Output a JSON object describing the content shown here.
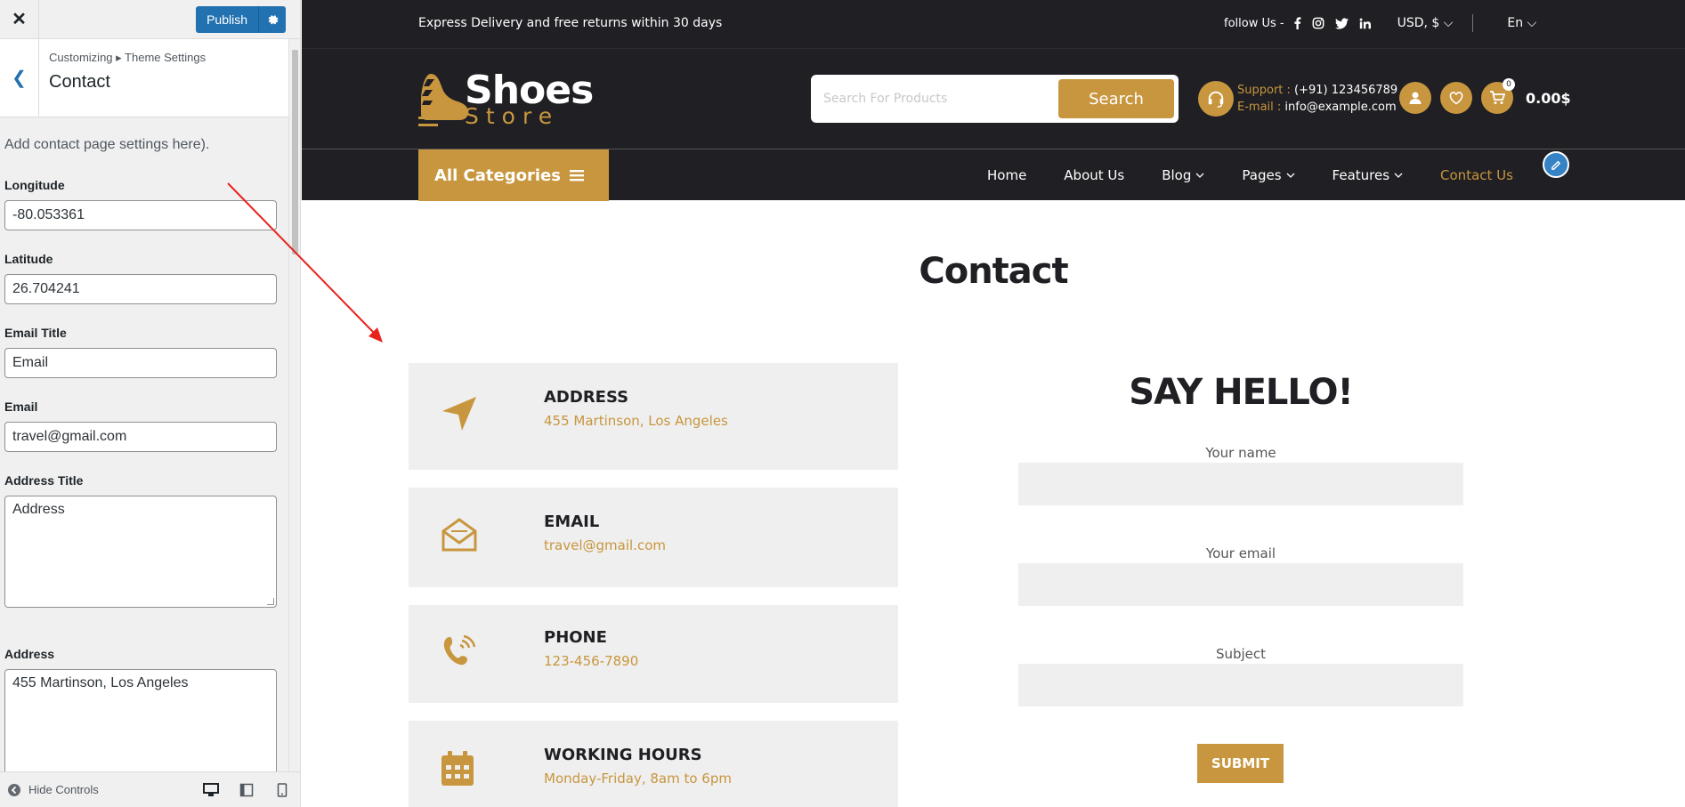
{
  "customizer": {
    "publish_label": "Publish",
    "breadcrumb": "Customizing ▸ Theme Settings",
    "section_title": "Contact",
    "description": "Add contact page settings here).",
    "fields": [
      {
        "label": "Longitude",
        "value": "-80.053361"
      },
      {
        "label": "Latitude",
        "value": "26.704241"
      },
      {
        "label": "Email Title",
        "value": "Email"
      },
      {
        "label": "Email",
        "value": "travel@gmail.com"
      }
    ],
    "address_title_label": "Address Title",
    "address_title_value": "Address",
    "address_label": "Address",
    "address_value": "455 Martinson, Los Angeles",
    "hide_controls": "Hide Controls"
  },
  "site": {
    "topbar_text": "Express Delivery and free returns within 30 days",
    "follow_label": "follow Us -",
    "currency": "USD, $",
    "language": "En",
    "logo_main": "Shoes",
    "logo_sub": "Store",
    "search_placeholder": "Search For Products",
    "search_button": "Search",
    "support_label": "Support :",
    "support_value": "(+91) 123456789",
    "email_label": "E-mail :",
    "email_value": "info@example.com",
    "cart_count": "0",
    "cart_total": "0.00$",
    "all_categories": "All Categories",
    "nav": [
      "Home",
      "About Us",
      "Blog",
      "Pages",
      "Features",
      "Contact Us"
    ],
    "page_title": "Contact",
    "cards": [
      {
        "title": "ADDRESS",
        "value": "455 Martinson, Los Angeles",
        "icon": "location-arrow-icon"
      },
      {
        "title": "EMAIL",
        "value": "travel@gmail.com",
        "icon": "envelope-open-icon"
      },
      {
        "title": "PHONE",
        "value": "123-456-7890",
        "icon": "phone-volume-icon"
      },
      {
        "title": "WORKING HOURS",
        "value": "Monday-Friday, 8am to 6pm",
        "icon": "calendar-icon"
      }
    ],
    "form_title": "SAY HELLO!",
    "form_labels": [
      "Your name",
      "Your email",
      "Subject"
    ],
    "submit_label": "SUBMIT"
  },
  "colors": {
    "accent": "#c8963e",
    "dark": "#1f1f24",
    "wp_blue": "#2271b1",
    "annotation_arrow": "#e8231d"
  }
}
